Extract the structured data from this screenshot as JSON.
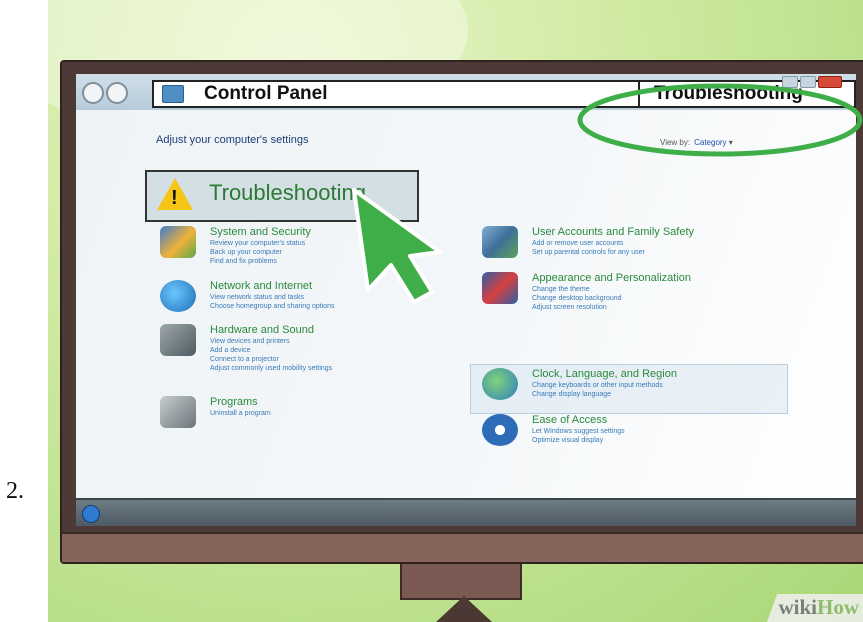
{
  "step": {
    "number": "2."
  },
  "window": {
    "address": "Control Panel",
    "search_value": "Troubleshooting"
  },
  "content": {
    "heading": "Adjust your computer's settings",
    "view_by": {
      "label": "View by:",
      "value": "Category"
    },
    "highlight_item": "Troubleshooting",
    "categories": [
      {
        "title": "System and Security",
        "links": [
          "Review your computer's status",
          "Back up your computer",
          "Find and fix problems"
        ]
      },
      {
        "title": "Network and Internet",
        "links": [
          "View network status and tasks",
          "Choose homegroup and sharing options"
        ]
      },
      {
        "title": "Hardware and Sound",
        "links": [
          "View devices and printers",
          "Add a device",
          "Connect to a projector",
          "Adjust commonly used mobility settings"
        ]
      },
      {
        "title": "Programs",
        "links": [
          "Uninstall a program"
        ]
      },
      {
        "title": "User Accounts and Family Safety",
        "links": [
          "Add or remove user accounts",
          "Set up parental controls for any user"
        ]
      },
      {
        "title": "Appearance and Personalization",
        "links": [
          "Change the theme",
          "Change desktop background",
          "Adjust screen resolution"
        ]
      },
      {
        "title": "Clock, Language, and Region",
        "links": [
          "Change keyboards or other input methods",
          "Change display language"
        ]
      },
      {
        "title": "Ease of Access",
        "links": [
          "Let Windows suggest settings",
          "Optimize visual display"
        ]
      }
    ]
  },
  "watermark": {
    "part1": "wiki",
    "part2": "How"
  },
  "colors": {
    "annotation": "#3fae49",
    "category_title": "#2a8a3e",
    "link": "#3a7bb8",
    "background": "#b8e08a"
  },
  "icons": {
    "system": "shield-globe-icon",
    "network": "globe-network-icon",
    "hardware": "printer-speaker-icon",
    "programs": "programs-box-icon",
    "users": "users-icon",
    "appearance": "paint-monitor-icon",
    "clock": "globe-clock-icon",
    "ease": "ease-of-access-icon",
    "warning": "warning-icon",
    "cursor": "arrow-cursor-icon"
  }
}
